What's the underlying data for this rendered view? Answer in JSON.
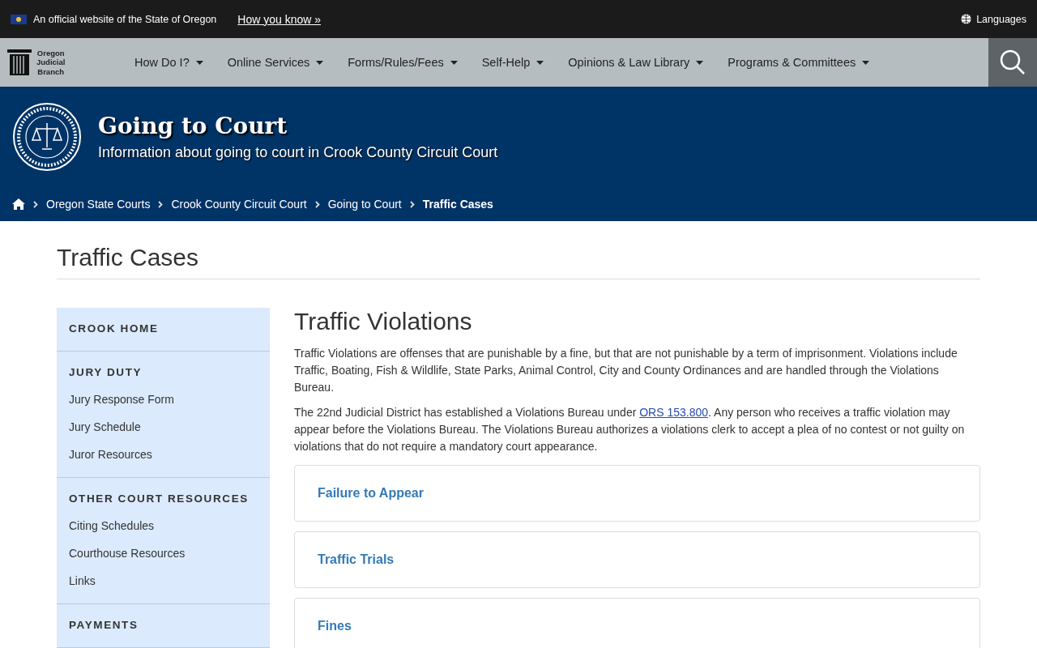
{
  "gov_banner": {
    "text": "An official website of the State of Oregon",
    "link": "How you know »",
    "languages": "Languages"
  },
  "logo": {
    "lines": [
      "Oregon",
      "Judicial",
      "Branch"
    ]
  },
  "nav": [
    "How Do I?",
    "Online Services",
    "Forms/Rules/Fees",
    "Self-Help",
    "Opinions & Law Library",
    "Programs & Committees"
  ],
  "hero": {
    "title": "Going to Court",
    "subtitle": "Information about going to court in Crook County Circuit Court"
  },
  "breadcrumbs": [
    {
      "label": "Oregon State Courts",
      "current": false
    },
    {
      "label": "Crook County Circuit Court",
      "current": false
    },
    {
      "label": "Going to Court",
      "current": false
    },
    {
      "label": "Traffic Cases",
      "current": true
    }
  ],
  "page_title": "Traffic Cases",
  "sidebar": [
    {
      "heading": "CROOK HOME"
    },
    {
      "heading": "JURY DUTY",
      "items": [
        "Jury Response Form",
        "Jury Schedule",
        "Juror Resources"
      ]
    },
    {
      "heading": "OTHER COURT RESOURCES",
      "items": [
        "Citing Schedules",
        "Courthouse Resources",
        "Links"
      ]
    },
    {
      "heading": "PAYMENTS"
    }
  ],
  "article": {
    "title": "Traffic Violations",
    "paragraphs": [
      {
        "text": "Traffic Violations are offenses that are punishable by a fine, but that are not punishable by a term of imprisonment. Violations include Traffic, Boating, Fish & Wildlife, State Parks, Animal Control, City and County Ordinances and are handled through the Violations Bureau."
      },
      {
        "before": "The 22nd Judicial District has established a Violations Bureau under ",
        "link": "ORS 153.800",
        "after": ".  Any person who receives a traffic violation may appear before the Violations Bureau.  The Violations Bureau authorizes a violations clerk to accept a plea of no contest or not guilty on violations that do not require a mandatory court appearance."
      }
    ]
  },
  "accordion": [
    "Failure to Appear",
    "Traffic Trials",
    "Fines"
  ]
}
